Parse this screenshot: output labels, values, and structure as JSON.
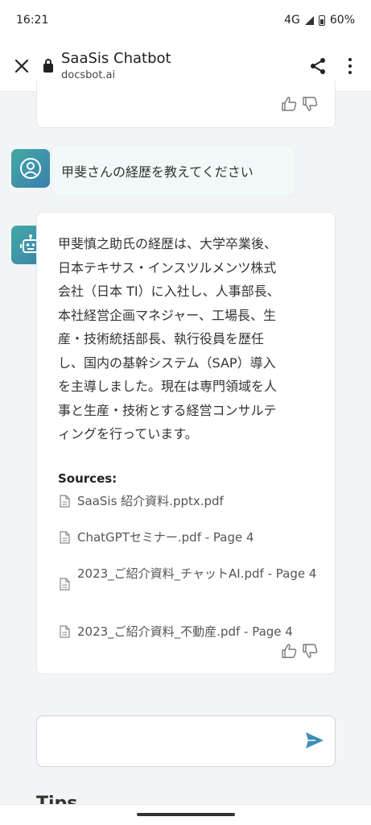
{
  "status_bar": {
    "time": "16:21",
    "network": "4G",
    "battery": "60%"
  },
  "browser": {
    "title": "SaaSis Chatbot",
    "url": "docsbot.ai"
  },
  "chat": {
    "user_message": "甲斐さんの経歴を教えてください",
    "answer_lines": [
      "甲斐慎之助氏の経歴は、大学卒業後、",
      "日本テキサス・インスツルメンツ株式",
      "会社（日本 TI）に入社し、人事部長、",
      "本社経営企画マネジャー、工場長、生",
      "産・技術統括部長、執行役員を歴任",
      "し、国内の基幹システム（SAP）導入",
      "を主導しました。現在は専門領域を人",
      "事と生産・技術とする経営コンサルテ",
      "ィングを行っています。"
    ],
    "sources_label": "Sources:",
    "sources": [
      "SaaSis 紹介資料.pptx.pdf",
      "ChatGPTセミナー.pdf - Page 4",
      "2023_ご紹介資料_チャットAI.pdf - Page 4",
      "2023_ご紹介資料_不動産.pdf - Page 4"
    ]
  },
  "input": {
    "placeholder": ""
  },
  "footer_heading": "Tips",
  "icons": {
    "close": "close-icon",
    "lock": "lock-icon",
    "share": "share-icon",
    "menu": "more-vert-icon",
    "user_avatar": "user-avatar-icon",
    "bot_avatar": "robot-icon",
    "thumbs_up": "thumbs-up-icon",
    "thumbs_down": "thumbs-down-icon",
    "document": "document-icon",
    "send": "send-icon"
  },
  "colors": {
    "accent": "#3b8fb5",
    "avatar_gradient_start": "#43a9a3",
    "avatar_gradient_end": "#3b7fb0"
  }
}
